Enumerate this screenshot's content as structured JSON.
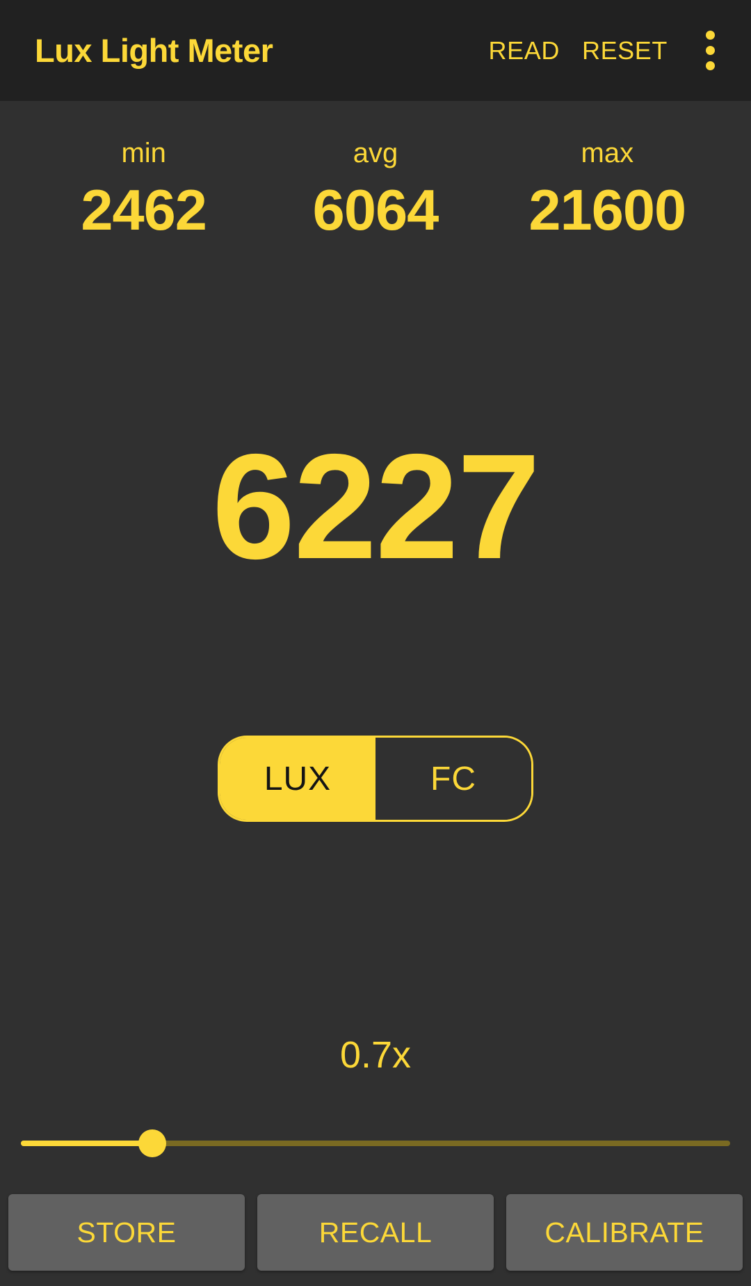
{
  "app": {
    "title": "Lux Light Meter",
    "accent_color": "#FCD838",
    "appbar_bg": "#212121",
    "body_bg": "#303030"
  },
  "appbar": {
    "read_label": "READ",
    "reset_label": "RESET",
    "overflow_icon": "more-vertical-icon"
  },
  "stats": [
    {
      "label": "min",
      "value": "2462"
    },
    {
      "label": "avg",
      "value": "6064"
    },
    {
      "label": "max",
      "value": "21600"
    }
  ],
  "reading": {
    "value": "6227",
    "unit": "LUX"
  },
  "unit_toggle": {
    "options": [
      {
        "label": "LUX",
        "selected": true
      },
      {
        "label": "FC",
        "selected": false
      }
    ]
  },
  "multiplier": {
    "label": "0.7x",
    "value": 0.7,
    "slider_percent": 18.5
  },
  "bottom_buttons": [
    {
      "label": "STORE"
    },
    {
      "label": "RECALL"
    },
    {
      "label": "CALIBRATE"
    }
  ]
}
